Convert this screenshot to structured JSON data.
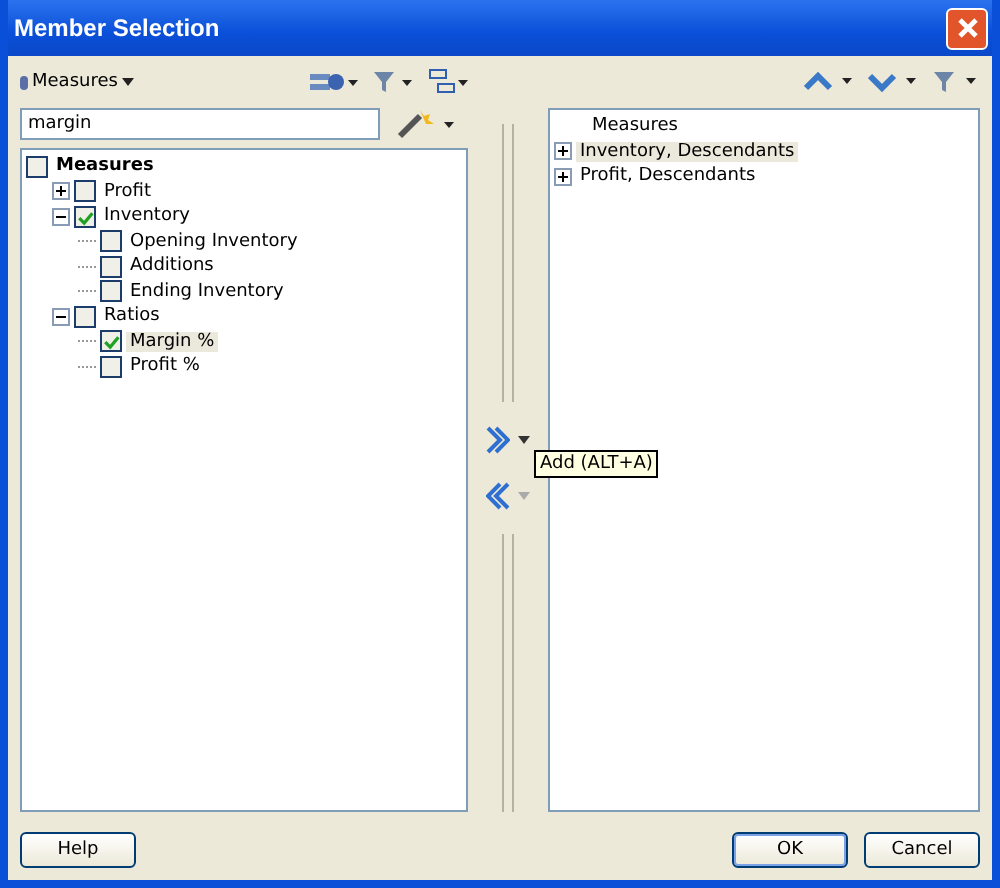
{
  "window": {
    "title": "Member Selection"
  },
  "dimension": {
    "label": "Measures"
  },
  "search": {
    "value": "margin"
  },
  "tree": [
    {
      "label": "Measures",
      "checked": false,
      "selected": false,
      "children": [
        {
          "label": "Profit",
          "checked": false,
          "selected": false,
          "expanded": false
        },
        {
          "label": "Inventory",
          "checked": true,
          "selected": false,
          "expanded": true,
          "children": [
            {
              "label": "Opening Inventory",
              "checked": false,
              "selected": false
            },
            {
              "label": "Additions",
              "checked": false,
              "selected": false
            },
            {
              "label": "Ending Inventory",
              "checked": false,
              "selected": false
            }
          ]
        },
        {
          "label": "Ratios",
          "checked": false,
          "selected": false,
          "expanded": true,
          "children": [
            {
              "label": "Margin %",
              "checked": true,
              "selected": true
            },
            {
              "label": "Profit %",
              "checked": false,
              "selected": false
            }
          ]
        }
      ]
    }
  ],
  "selection_header": "Measures",
  "selection": [
    {
      "label": "Inventory, Descendants",
      "selected": true
    },
    {
      "label": "Profit, Descendants",
      "selected": false
    }
  ],
  "tooltip": "Add (ALT+A)",
  "buttons": {
    "help": "Help",
    "ok": "OK",
    "cancel": "Cancel"
  }
}
